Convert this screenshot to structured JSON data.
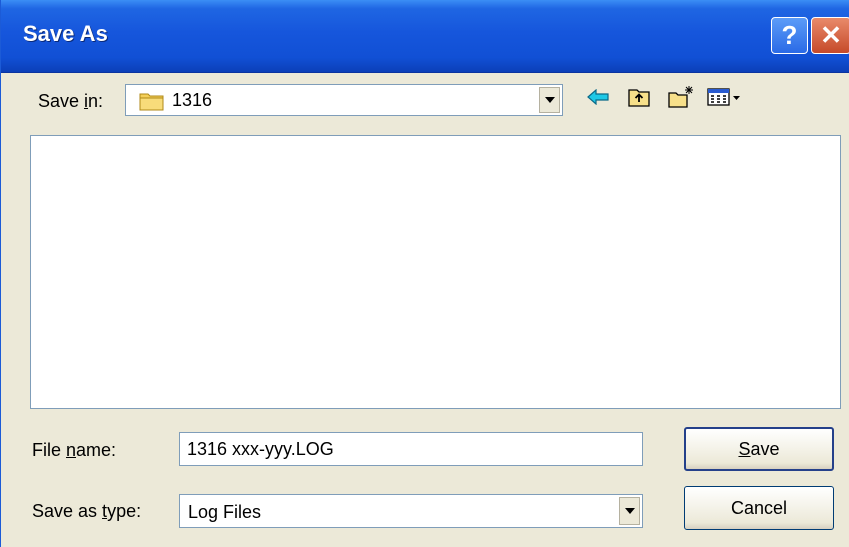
{
  "window": {
    "title": "Save As",
    "help_label": "?",
    "close_label": "✕"
  },
  "save_in": {
    "label_pre": "Save ",
    "label_accel": "i",
    "label_post": "n:",
    "value": "1316"
  },
  "toolbar": {
    "icons": [
      "back-arrow-icon",
      "up-folder-icon",
      "new-folder-icon",
      "view-menu-icon"
    ]
  },
  "file_name": {
    "label_pre": "File ",
    "label_accel": "n",
    "label_post": "ame:",
    "value": "1316 xxx-yyy.LOG"
  },
  "save_as_type": {
    "label_pre": "Save as ",
    "label_accel": "t",
    "label_post": "ype:",
    "value": "Log Files"
  },
  "buttons": {
    "save_accel": "S",
    "save_rest": "ave",
    "cancel": "Cancel"
  },
  "colors": {
    "titlebar": "#1656dc",
    "dialog_bg": "#ece9d8",
    "close": "#c64a2a",
    "folder": "#f4cf59",
    "back_arrow": "#0aa6c8"
  }
}
